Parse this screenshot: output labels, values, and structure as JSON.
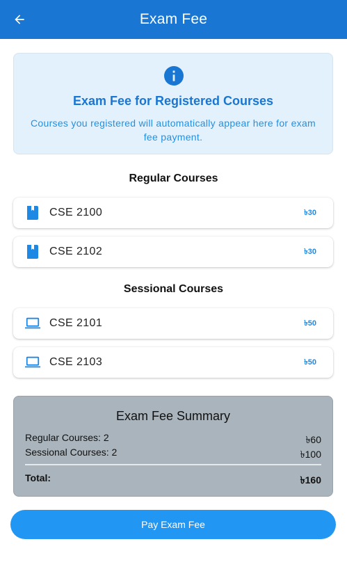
{
  "appbar": {
    "title": "Exam Fee"
  },
  "info": {
    "title": "Exam Fee for Registered Courses",
    "text": "Courses you registered will automatically appear here for exam fee payment."
  },
  "regular": {
    "heading": "Regular Courses",
    "items": [
      {
        "code": "CSE 2100",
        "fee": "৳30",
        "icon": "book-icon"
      },
      {
        "code": "CSE 2102",
        "fee": "৳30",
        "icon": "book-icon"
      }
    ]
  },
  "sessional": {
    "heading": "Sessional Courses",
    "items": [
      {
        "code": "CSE 2101",
        "fee": "৳50",
        "icon": "laptop-icon"
      },
      {
        "code": "CSE 2103",
        "fee": "৳50",
        "icon": "laptop-icon"
      }
    ]
  },
  "summary": {
    "title": "Exam Fee Summary",
    "regular_label": "Regular Courses: 2",
    "regular_amount": "৳60",
    "sessional_label": "Sessional Courses: 2",
    "sessional_amount": "৳100",
    "total_label": "Total:",
    "total_amount": "৳160"
  },
  "pay_button": {
    "label": "Pay Exam Fee"
  },
  "colors": {
    "primary": "#1976d2",
    "accent": "#2196f3",
    "info_bg": "#e3f1fc",
    "summary_bg": "#aab4bc"
  }
}
